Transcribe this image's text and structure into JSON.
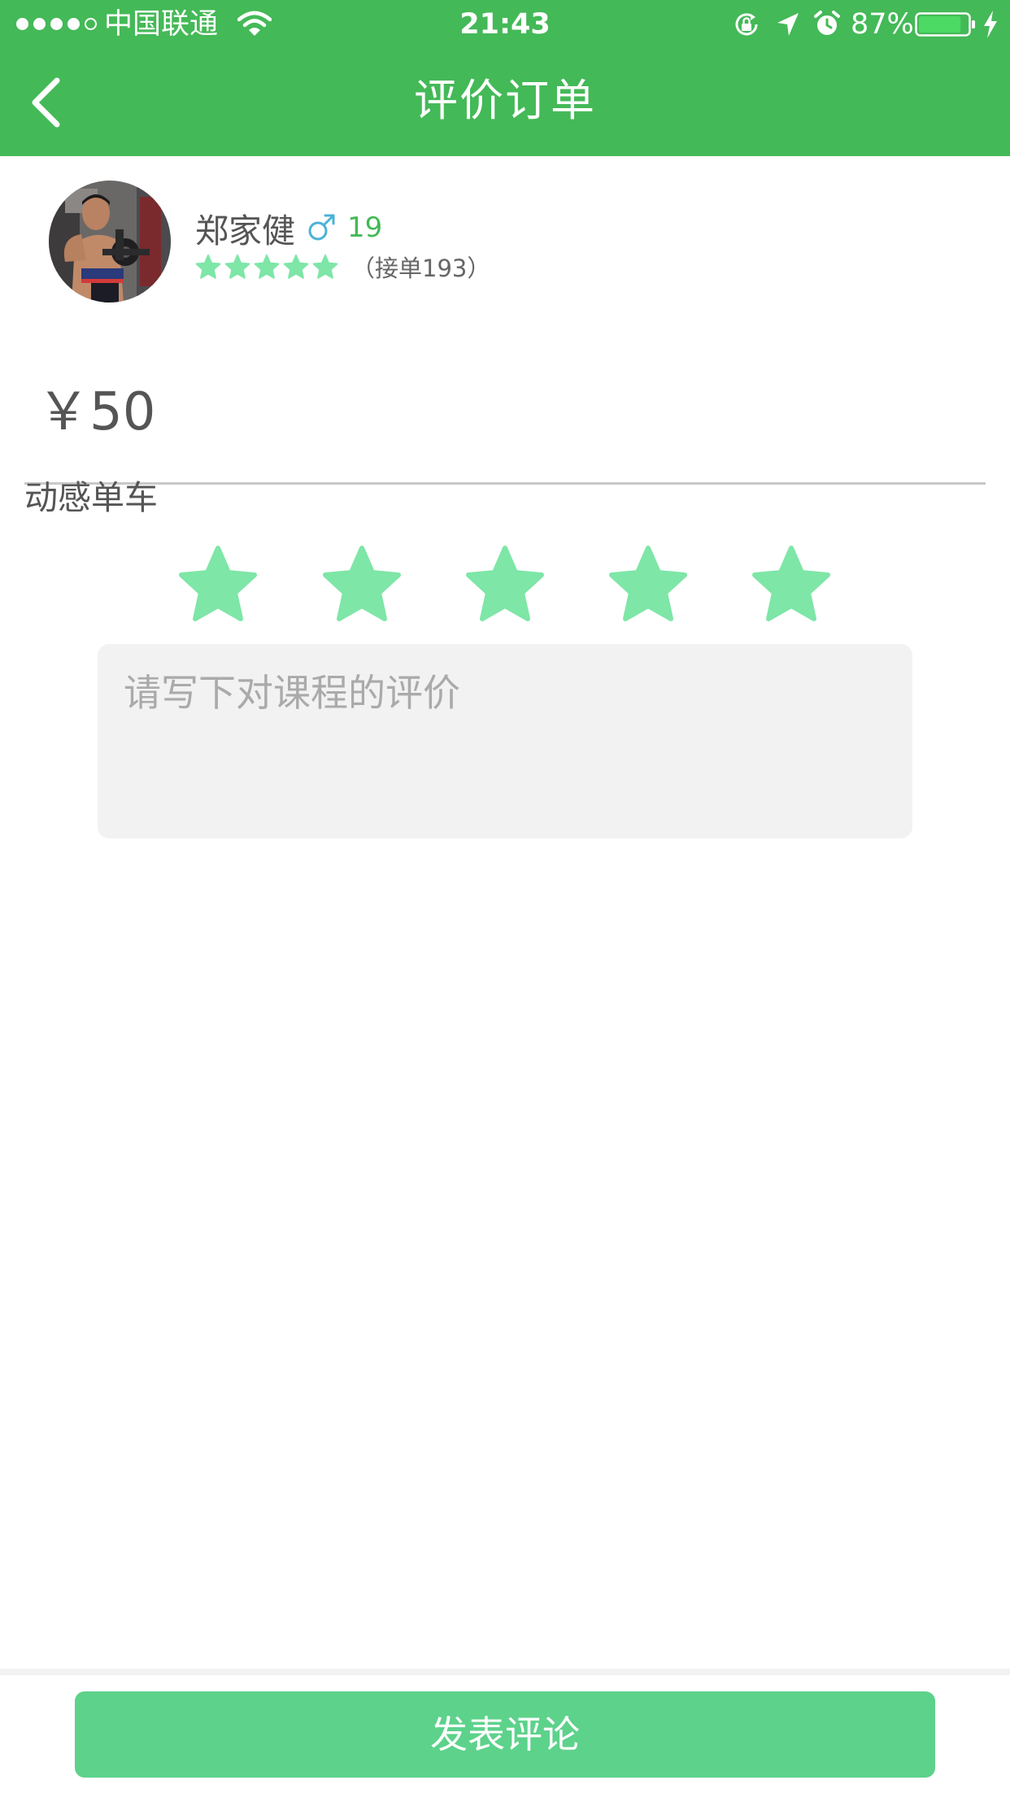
{
  "status_bar": {
    "carrier": "中国联通",
    "time": "21:43",
    "battery_percent": "87%",
    "battery_level": 0.87,
    "signal_bars": 4,
    "signal_total": 5,
    "icons": [
      "wifi-icon",
      "lock-rotation-icon",
      "location-icon",
      "alarm-icon",
      "battery-icon",
      "charging-icon"
    ]
  },
  "nav": {
    "title": "评价订单",
    "back_icon": "chevron-left-icon"
  },
  "coach": {
    "name": "郑家健",
    "gender_icon": "male-icon",
    "age": "19",
    "rating": 5,
    "order_count": "（接单193）"
  },
  "course": {
    "price": "￥50",
    "name": "动感单车"
  },
  "review": {
    "rating": 5,
    "max_rating": 5,
    "placeholder": "请写下对课程的评价",
    "value": ""
  },
  "submit": {
    "label": "发表评论"
  },
  "colors": {
    "header": "#44b957",
    "star": "#7ee6a7",
    "button": "#5dd28b",
    "age": "#44b957",
    "male_icon": "#4ab2d8",
    "input_bg": "#f2f2f2"
  }
}
